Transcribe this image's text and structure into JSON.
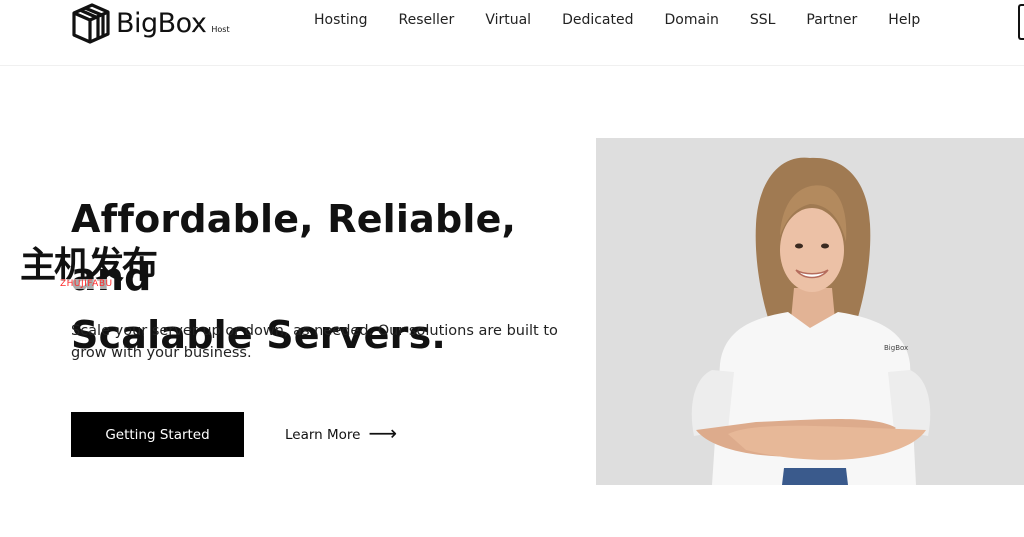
{
  "header": {
    "logo_text": "BigBox",
    "logo_sub": "Host",
    "nav": [
      "Hosting",
      "Reseller",
      "Virtual",
      "Dedicated",
      "Domain",
      "SSL",
      "Partner",
      "Help"
    ]
  },
  "hero": {
    "title_line1": "Affordable, Reliable, and",
    "title_line2": "Scalable Servers.",
    "subtitle": "Scale your server up or down, as needed. Our solutions are built to grow with your business.",
    "primary_button": "Getting Started",
    "secondary_link": "Learn More",
    "arrow": "⟶"
  },
  "watermark": {
    "cn": "主机发布",
    "en": "ZHUJIFABU"
  },
  "image": {
    "shirt_logo": "BigBox"
  },
  "colors": {
    "accent": "#000000",
    "image_bg": "#dedede",
    "watermark_red": "#ff2a2a"
  }
}
